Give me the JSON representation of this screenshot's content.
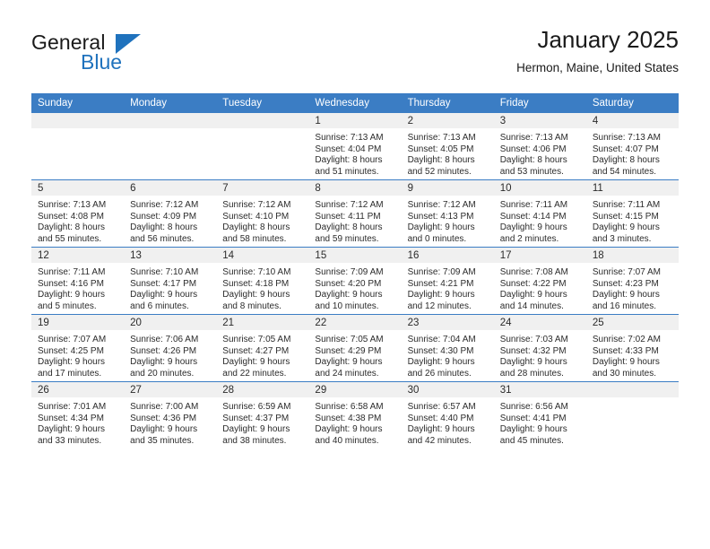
{
  "logo": {
    "word_top": "General",
    "word_bottom": "Blue",
    "accent_color": "#1f72bd"
  },
  "header": {
    "title": "January 2025",
    "subtitle": "Hermon, Maine, United States"
  },
  "theme": {
    "header_blue": "#3b7dc4",
    "daynum_strip": "#f0f0f0",
    "text": "#2b2b2b"
  },
  "calendar": {
    "weekday_headers": [
      "Sunday",
      "Monday",
      "Tuesday",
      "Wednesday",
      "Thursday",
      "Friday",
      "Saturday"
    ],
    "weeks": [
      [
        {
          "day": "",
          "empty": true,
          "sunrise": "",
          "sunset": "",
          "daylight_line1": "",
          "daylight_line2": ""
        },
        {
          "day": "",
          "empty": true,
          "sunrise": "",
          "sunset": "",
          "daylight_line1": "",
          "daylight_line2": ""
        },
        {
          "day": "",
          "empty": true,
          "sunrise": "",
          "sunset": "",
          "daylight_line1": "",
          "daylight_line2": ""
        },
        {
          "day": "1",
          "empty": false,
          "sunrise": "Sunrise: 7:13 AM",
          "sunset": "Sunset: 4:04 PM",
          "daylight_line1": "Daylight: 8 hours",
          "daylight_line2": "and 51 minutes."
        },
        {
          "day": "2",
          "empty": false,
          "sunrise": "Sunrise: 7:13 AM",
          "sunset": "Sunset: 4:05 PM",
          "daylight_line1": "Daylight: 8 hours",
          "daylight_line2": "and 52 minutes."
        },
        {
          "day": "3",
          "empty": false,
          "sunrise": "Sunrise: 7:13 AM",
          "sunset": "Sunset: 4:06 PM",
          "daylight_line1": "Daylight: 8 hours",
          "daylight_line2": "and 53 minutes."
        },
        {
          "day": "4",
          "empty": false,
          "sunrise": "Sunrise: 7:13 AM",
          "sunset": "Sunset: 4:07 PM",
          "daylight_line1": "Daylight: 8 hours",
          "daylight_line2": "and 54 minutes."
        }
      ],
      [
        {
          "day": "5",
          "empty": false,
          "sunrise": "Sunrise: 7:13 AM",
          "sunset": "Sunset: 4:08 PM",
          "daylight_line1": "Daylight: 8 hours",
          "daylight_line2": "and 55 minutes."
        },
        {
          "day": "6",
          "empty": false,
          "sunrise": "Sunrise: 7:12 AM",
          "sunset": "Sunset: 4:09 PM",
          "daylight_line1": "Daylight: 8 hours",
          "daylight_line2": "and 56 minutes."
        },
        {
          "day": "7",
          "empty": false,
          "sunrise": "Sunrise: 7:12 AM",
          "sunset": "Sunset: 4:10 PM",
          "daylight_line1": "Daylight: 8 hours",
          "daylight_line2": "and 58 minutes."
        },
        {
          "day": "8",
          "empty": false,
          "sunrise": "Sunrise: 7:12 AM",
          "sunset": "Sunset: 4:11 PM",
          "daylight_line1": "Daylight: 8 hours",
          "daylight_line2": "and 59 minutes."
        },
        {
          "day": "9",
          "empty": false,
          "sunrise": "Sunrise: 7:12 AM",
          "sunset": "Sunset: 4:13 PM",
          "daylight_line1": "Daylight: 9 hours",
          "daylight_line2": "and 0 minutes."
        },
        {
          "day": "10",
          "empty": false,
          "sunrise": "Sunrise: 7:11 AM",
          "sunset": "Sunset: 4:14 PM",
          "daylight_line1": "Daylight: 9 hours",
          "daylight_line2": "and 2 minutes."
        },
        {
          "day": "11",
          "empty": false,
          "sunrise": "Sunrise: 7:11 AM",
          "sunset": "Sunset: 4:15 PM",
          "daylight_line1": "Daylight: 9 hours",
          "daylight_line2": "and 3 minutes."
        }
      ],
      [
        {
          "day": "12",
          "empty": false,
          "sunrise": "Sunrise: 7:11 AM",
          "sunset": "Sunset: 4:16 PM",
          "daylight_line1": "Daylight: 9 hours",
          "daylight_line2": "and 5 minutes."
        },
        {
          "day": "13",
          "empty": false,
          "sunrise": "Sunrise: 7:10 AM",
          "sunset": "Sunset: 4:17 PM",
          "daylight_line1": "Daylight: 9 hours",
          "daylight_line2": "and 6 minutes."
        },
        {
          "day": "14",
          "empty": false,
          "sunrise": "Sunrise: 7:10 AM",
          "sunset": "Sunset: 4:18 PM",
          "daylight_line1": "Daylight: 9 hours",
          "daylight_line2": "and 8 minutes."
        },
        {
          "day": "15",
          "empty": false,
          "sunrise": "Sunrise: 7:09 AM",
          "sunset": "Sunset: 4:20 PM",
          "daylight_line1": "Daylight: 9 hours",
          "daylight_line2": "and 10 minutes."
        },
        {
          "day": "16",
          "empty": false,
          "sunrise": "Sunrise: 7:09 AM",
          "sunset": "Sunset: 4:21 PM",
          "daylight_line1": "Daylight: 9 hours",
          "daylight_line2": "and 12 minutes."
        },
        {
          "day": "17",
          "empty": false,
          "sunrise": "Sunrise: 7:08 AM",
          "sunset": "Sunset: 4:22 PM",
          "daylight_line1": "Daylight: 9 hours",
          "daylight_line2": "and 14 minutes."
        },
        {
          "day": "18",
          "empty": false,
          "sunrise": "Sunrise: 7:07 AM",
          "sunset": "Sunset: 4:23 PM",
          "daylight_line1": "Daylight: 9 hours",
          "daylight_line2": "and 16 minutes."
        }
      ],
      [
        {
          "day": "19",
          "empty": false,
          "sunrise": "Sunrise: 7:07 AM",
          "sunset": "Sunset: 4:25 PM",
          "daylight_line1": "Daylight: 9 hours",
          "daylight_line2": "and 17 minutes."
        },
        {
          "day": "20",
          "empty": false,
          "sunrise": "Sunrise: 7:06 AM",
          "sunset": "Sunset: 4:26 PM",
          "daylight_line1": "Daylight: 9 hours",
          "daylight_line2": "and 20 minutes."
        },
        {
          "day": "21",
          "empty": false,
          "sunrise": "Sunrise: 7:05 AM",
          "sunset": "Sunset: 4:27 PM",
          "daylight_line1": "Daylight: 9 hours",
          "daylight_line2": "and 22 minutes."
        },
        {
          "day": "22",
          "empty": false,
          "sunrise": "Sunrise: 7:05 AM",
          "sunset": "Sunset: 4:29 PM",
          "daylight_line1": "Daylight: 9 hours",
          "daylight_line2": "and 24 minutes."
        },
        {
          "day": "23",
          "empty": false,
          "sunrise": "Sunrise: 7:04 AM",
          "sunset": "Sunset: 4:30 PM",
          "daylight_line1": "Daylight: 9 hours",
          "daylight_line2": "and 26 minutes."
        },
        {
          "day": "24",
          "empty": false,
          "sunrise": "Sunrise: 7:03 AM",
          "sunset": "Sunset: 4:32 PM",
          "daylight_line1": "Daylight: 9 hours",
          "daylight_line2": "and 28 minutes."
        },
        {
          "day": "25",
          "empty": false,
          "sunrise": "Sunrise: 7:02 AM",
          "sunset": "Sunset: 4:33 PM",
          "daylight_line1": "Daylight: 9 hours",
          "daylight_line2": "and 30 minutes."
        }
      ],
      [
        {
          "day": "26",
          "empty": false,
          "sunrise": "Sunrise: 7:01 AM",
          "sunset": "Sunset: 4:34 PM",
          "daylight_line1": "Daylight: 9 hours",
          "daylight_line2": "and 33 minutes."
        },
        {
          "day": "27",
          "empty": false,
          "sunrise": "Sunrise: 7:00 AM",
          "sunset": "Sunset: 4:36 PM",
          "daylight_line1": "Daylight: 9 hours",
          "daylight_line2": "and 35 minutes."
        },
        {
          "day": "28",
          "empty": false,
          "sunrise": "Sunrise: 6:59 AM",
          "sunset": "Sunset: 4:37 PM",
          "daylight_line1": "Daylight: 9 hours",
          "daylight_line2": "and 38 minutes."
        },
        {
          "day": "29",
          "empty": false,
          "sunrise": "Sunrise: 6:58 AM",
          "sunset": "Sunset: 4:38 PM",
          "daylight_line1": "Daylight: 9 hours",
          "daylight_line2": "and 40 minutes."
        },
        {
          "day": "30",
          "empty": false,
          "sunrise": "Sunrise: 6:57 AM",
          "sunset": "Sunset: 4:40 PM",
          "daylight_line1": "Daylight: 9 hours",
          "daylight_line2": "and 42 minutes."
        },
        {
          "day": "31",
          "empty": false,
          "sunrise": "Sunrise: 6:56 AM",
          "sunset": "Sunset: 4:41 PM",
          "daylight_line1": "Daylight: 9 hours",
          "daylight_line2": "and 45 minutes."
        },
        {
          "day": "",
          "empty": true,
          "sunrise": "",
          "sunset": "",
          "daylight_line1": "",
          "daylight_line2": ""
        }
      ]
    ]
  }
}
